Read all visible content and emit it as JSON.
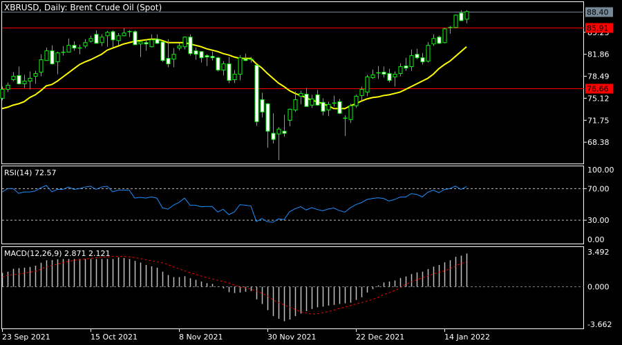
{
  "header": {
    "title": "XBRUSD, Daily:  Brent Crude Oil (Spot)"
  },
  "colors": {
    "bull": "#00ff00",
    "bear_body": "#ffffff",
    "ma": "#ffff00",
    "level_line": "#ff0000",
    "current_price_bg": "#778899",
    "rsi": "#1e90ff",
    "macd_hist": "#c0c0c0",
    "macd_signal": "#ff0000",
    "grid_dash": "#c0c0c0",
    "background": "#000000",
    "frame": "#ffffff"
  },
  "chart_data": [
    {
      "type": "candlestick",
      "title": "XBRUSD, Daily:  Brent Crude Oil (Spot)",
      "ylim": [
        65.12,
        89.86
      ],
      "yticks": [
        "85.23",
        "81.86",
        "78.49",
        "75.12",
        "71.75",
        "68.38"
      ],
      "current_price": {
        "value": 88.4,
        "label": "88.40"
      },
      "levels": [
        {
          "value": 85.91,
          "label": "85.91"
        },
        {
          "value": 76.66,
          "label": "76.66"
        }
      ],
      "ohlc": [
        [
          75.12,
          76.91,
          74.81,
          76.49
        ],
        [
          76.49,
          77.54,
          76.07,
          77.12
        ],
        [
          77.97,
          79.12,
          77.75,
          78.49
        ],
        [
          78.6,
          79.97,
          77.23,
          77.33
        ],
        [
          77.33,
          78.7,
          76.7,
          77.75
        ],
        [
          77.75,
          79.23,
          76.49,
          78.18
        ],
        [
          78.49,
          79.33,
          77.33,
          78.91
        ],
        [
          79.12,
          81.86,
          78.49,
          81.02
        ],
        [
          80.91,
          82.91,
          80.91,
          82.39
        ],
        [
          82.39,
          83.23,
          80.28,
          80.39
        ],
        [
          80.7,
          82.28,
          78.81,
          82.07
        ],
        [
          82.18,
          83.12,
          81.65,
          82.2
        ],
        [
          82.18,
          84.28,
          82.18,
          83.23
        ],
        [
          83.23,
          83.86,
          82.39,
          82.81
        ],
        [
          82.81,
          83.33,
          81.86,
          82.85
        ],
        [
          83.12,
          84.18,
          82.81,
          83.65
        ],
        [
          83.86,
          84.7,
          83.65,
          84.28
        ],
        [
          84.91,
          85.54,
          83.54,
          83.54
        ],
        [
          83.65,
          84.91,
          83.12,
          84.49
        ],
        [
          84.7,
          85.44,
          83.02,
          85.23
        ],
        [
          85.33,
          85.54,
          82.91,
          84.07
        ],
        [
          83.96,
          85.12,
          83.23,
          84.7
        ],
        [
          84.7,
          85.86,
          84.6,
          85.12
        ],
        [
          85.33,
          85.54,
          84.49,
          85.36
        ],
        [
          85.33,
          85.54,
          83.33,
          83.33
        ],
        [
          83.44,
          83.96,
          81.44,
          83.75
        ],
        [
          83.65,
          84.07,
          82.39,
          83.44
        ],
        [
          83.02,
          84.91,
          82.91,
          84.07
        ],
        [
          84.18,
          84.91,
          83.44,
          83.54
        ],
        [
          83.75,
          83.75,
          80.7,
          80.91
        ],
        [
          81.23,
          84.18,
          79.86,
          80.39
        ],
        [
          81.12,
          82.81,
          79.86,
          81.86
        ],
        [
          82.81,
          83.54,
          82.49,
          83.12
        ],
        [
          83.02,
          84.6,
          82.6,
          84.49
        ],
        [
          84.49,
          84.91,
          81.65,
          81.96
        ],
        [
          82.39,
          82.91,
          81.02,
          81.86
        ],
        [
          82.28,
          82.28,
          80.6,
          81.33
        ],
        [
          81.65,
          81.86,
          80.07,
          81.44
        ],
        [
          81.54,
          82.28,
          80.91,
          81.33
        ],
        [
          81.33,
          81.44,
          79.23,
          79.44
        ],
        [
          79.44,
          80.81,
          78.6,
          80.39
        ],
        [
          80.39,
          81.44,
          77.44,
          77.86
        ],
        [
          77.97,
          79.44,
          77.44,
          78.81
        ],
        [
          78.81,
          81.75,
          77.86,
          81.33
        ],
        [
          81.12,
          81.96,
          80.81,
          80.91
        ],
        [
          81.12,
          81.44,
          80.6,
          81.1
        ],
        [
          80.18,
          80.28,
          70.91,
          71.54
        ],
        [
          74.91,
          75.97,
          72.18,
          73.02
        ],
        [
          74.28,
          74.39,
          67.54,
          70.07
        ],
        [
          69.75,
          72.81,
          68.18,
          68.81
        ],
        [
          69.65,
          70.7,
          65.65,
          70.39
        ],
        [
          70.07,
          72.6,
          69.23,
          69.75
        ],
        [
          71.75,
          73.54,
          70.81,
          73.44
        ],
        [
          73.33,
          76.18,
          73.02,
          74.91
        ],
        [
          75.44,
          76.28,
          74.18,
          75.86
        ],
        [
          75.75,
          76.7,
          73.86,
          73.86
        ],
        [
          74.07,
          75.65,
          73.65,
          75.02
        ],
        [
          75.65,
          76.39,
          73.97,
          74.07
        ],
        [
          74.49,
          75.12,
          72.49,
          73.12
        ],
        [
          73.33,
          74.6,
          72.39,
          74.18
        ],
        [
          74.39,
          75.54,
          73.86,
          74.41
        ],
        [
          74.6,
          75.02,
          72.7,
          72.81
        ],
        [
          72.07,
          72.49,
          69.33,
          72.09
        ],
        [
          71.86,
          74.28,
          71.33,
          73.97
        ],
        [
          73.97,
          75.65,
          73.65,
          75.44
        ],
        [
          75.54,
          76.91,
          74.81,
          76.49
        ],
        [
          76.07,
          78.7,
          75.44,
          78.39
        ],
        [
          78.28,
          79.54,
          78.07,
          78.7
        ],
        [
          79.02,
          80.07,
          78.07,
          79.04
        ],
        [
          79.12,
          79.97,
          78.28,
          78.81
        ],
        [
          78.91,
          79.65,
          77.54,
          77.86
        ],
        [
          78.39,
          79.23,
          76.91,
          78.81
        ],
        [
          78.91,
          80.49,
          78.49,
          79.97
        ],
        [
          80.07,
          81.33,
          79.33,
          79.75
        ],
        [
          79.97,
          82.6,
          79.33,
          81.65
        ],
        [
          81.86,
          82.7,
          81.12,
          81.33
        ],
        [
          81.33,
          82.07,
          80.28,
          80.7
        ],
        [
          80.81,
          83.75,
          80.6,
          83.23
        ],
        [
          83.44,
          84.91,
          83.12,
          84.28
        ],
        [
          84.49,
          84.7,
          83.44,
          83.54
        ],
        [
          83.65,
          85.96,
          83.54,
          85.75
        ],
        [
          85.96,
          86.18,
          85.02,
          85.98
        ],
        [
          85.96,
          87.97,
          85.86,
          87.86
        ],
        [
          88.18,
          88.6,
          87.02,
          87.02
        ],
        [
          87.23,
          88.6,
          86.6,
          88.4
        ]
      ],
      "moving_average": [
        73.54,
        73.75,
        74.07,
        74.28,
        74.6,
        75.23,
        75.65,
        76.28,
        77.02,
        77.23,
        77.75,
        78.39,
        79.02,
        79.65,
        80.28,
        80.7,
        81.02,
        81.44,
        81.86,
        82.49,
        82.81,
        83.12,
        83.44,
        83.65,
        83.86,
        83.96,
        84.07,
        84.18,
        84.18,
        83.96,
        83.65,
        83.65,
        83.65,
        83.65,
        83.44,
        83.23,
        83.02,
        82.7,
        82.49,
        82.28,
        81.96,
        81.75,
        81.44,
        81.23,
        81.23,
        81.23,
        80.39,
        79.75,
        78.91,
        78.18,
        77.44,
        76.91,
        76.28,
        75.86,
        75.54,
        75.23,
        74.81,
        74.6,
        74.28,
        73.97,
        73.54,
        73.54,
        73.54,
        73.97,
        74.28,
        74.7,
        75.02,
        75.23,
        75.33,
        75.54,
        75.65,
        75.86,
        76.07,
        76.49,
        76.91,
        77.33,
        77.75,
        78.18,
        78.81,
        79.65,
        80.28,
        80.81,
        81.54,
        82.28,
        83.02
      ],
      "x_labels": [
        {
          "index": 0,
          "label": "23 Sep 2021"
        },
        {
          "index": 16,
          "label": "15 Oct 2021"
        },
        {
          "index": 32,
          "label": "8 Nov 2021"
        },
        {
          "index": 48,
          "label": "30 Nov 2021"
        },
        {
          "index": 64,
          "label": "22 Dec 2021"
        },
        {
          "index": 80,
          "label": "14 Jan 2022"
        }
      ]
    },
    {
      "type": "line",
      "title": "RSI(14) 72.57",
      "ylim": [
        0,
        100
      ],
      "yticks": [
        "100.00",
        "70.00",
        "30.00",
        "0.00"
      ],
      "levels": [
        70,
        30
      ],
      "values": [
        65.7,
        70,
        70,
        64,
        65.7,
        65.7,
        67,
        71,
        74,
        66,
        69,
        69,
        72,
        69,
        70,
        72,
        73,
        69,
        72,
        73,
        66,
        68,
        68,
        68,
        58,
        59,
        58,
        59.5,
        58,
        45.7,
        44,
        49,
        52.6,
        58,
        49,
        49,
        47,
        47.4,
        47.4,
        40.4,
        43.9,
        37,
        40.4,
        49.7,
        49,
        48,
        28.3,
        32,
        28,
        27.4,
        31.7,
        30.8,
        40.7,
        44.5,
        47.1,
        43,
        45.9,
        43.6,
        41.9,
        44.2,
        45.4,
        42.2,
        40.2,
        45.9,
        49.7,
        52.3,
        56.3,
        57.5,
        58.4,
        57.5,
        54.3,
        56.3,
        59.3,
        59.3,
        63.6,
        62.7,
        59.5,
        65.4,
        68,
        64.8,
        68.9,
        70,
        73.2,
        68.9,
        72.57
      ]
    },
    {
      "type": "bar",
      "title": "MACD(12,26,9) 2.871 2.121",
      "ylim": [
        -3.662,
        3.492
      ],
      "yticks": [
        "3.492",
        "0.000",
        "-3.662"
      ],
      "histogram": [
        1.2,
        1.3,
        1.55,
        1.61,
        1.65,
        1.71,
        1.82,
        2.07,
        2.29,
        2.31,
        2.38,
        2.4,
        2.4,
        2.4,
        2.4,
        2.4,
        2.4,
        2.4,
        2.4,
        2.4,
        2.4,
        2.54,
        2.48,
        2.4,
        2.23,
        2.09,
        1.88,
        1.76,
        1.65,
        1.3,
        1.01,
        0.83,
        0.83,
        0.91,
        0.74,
        0.6,
        0.45,
        0.31,
        0.25,
        0.02,
        -0.14,
        -0.47,
        -0.54,
        -0.5,
        -0.43,
        -0.37,
        -1.09,
        -1.49,
        -2.02,
        -2.54,
        -2.77,
        -2.98,
        -2.83,
        -2.54,
        -2.31,
        -2.11,
        -1.92,
        -1.78,
        -1.72,
        -1.63,
        -1.57,
        -1.49,
        -1.43,
        -1.38,
        -1.14,
        -0.91,
        -0.5,
        -0.21,
        0.12,
        0.37,
        0.45,
        0.54,
        0.76,
        0.89,
        1.1,
        1.24,
        1.3,
        1.53,
        1.74,
        1.88,
        2.11,
        2.29,
        2.58,
        2.69,
        2.871
      ],
      "signal": [
        0.85,
        0.97,
        1.05,
        1.1,
        1.18,
        1.26,
        1.34,
        1.51,
        1.71,
        1.82,
        1.96,
        2.07,
        2.17,
        2.29,
        2.34,
        2.38,
        2.45,
        2.5,
        2.55,
        2.58,
        2.61,
        2.62,
        2.62,
        2.58,
        2.52,
        2.44,
        2.34,
        2.25,
        2.15,
        2.07,
        1.92,
        1.72,
        1.55,
        1.38,
        1.22,
        1.07,
        0.93,
        0.79,
        0.68,
        0.56,
        0.45,
        0.33,
        0.15,
        -0.04,
        -0.1,
        -0.21,
        -0.37,
        -0.56,
        -0.79,
        -1.14,
        -1.36,
        -1.57,
        -1.76,
        -1.96,
        -2.17,
        -2.27,
        -2.36,
        -2.34,
        -2.25,
        -2.15,
        -2.02,
        -1.88,
        -1.76,
        -1.63,
        -1.49,
        -1.38,
        -1.24,
        -1.1,
        -0.93,
        -0.68,
        -0.52,
        -0.33,
        -0.1,
        0.21,
        0.41,
        0.6,
        0.78,
        0.93,
        1.1,
        1.26,
        1.36,
        1.57,
        1.76,
        2.02,
        2.121
      ]
    }
  ]
}
